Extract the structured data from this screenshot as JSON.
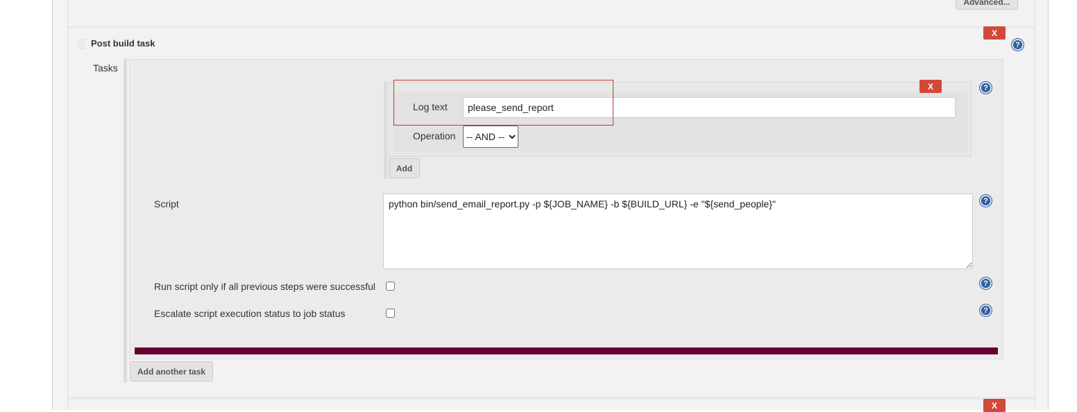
{
  "top": {
    "advanced_label": "Advanced..."
  },
  "section": {
    "title": "Post build task",
    "delete_label": "X",
    "help_icon": "help-icon"
  },
  "tasks": {
    "label": "Tasks",
    "log_block": {
      "delete_label": "X",
      "log_text_label": "Log text",
      "log_text_value": "please_send_report",
      "operation_label": "Operation",
      "operation_value": "-- AND --",
      "add_label": "Add"
    },
    "script_label": "Script",
    "script_value": "python bin/send_email_report.py -p ${JOB_NAME} -b ${BUILD_URL} -e \"${send_people}\"",
    "run_if_success_label": "Run script only if all previous steps were successful",
    "run_if_success_checked": false,
    "escalate_label": "Escalate script execution status to job status",
    "escalate_checked": false,
    "add_another_label": "Add another task"
  },
  "next_section": {
    "delete_label": "X"
  },
  "colors": {
    "delete": "#d24939",
    "separator_bar": "#660033",
    "highlight": "#c0392b",
    "help": "#2f5f9c"
  }
}
